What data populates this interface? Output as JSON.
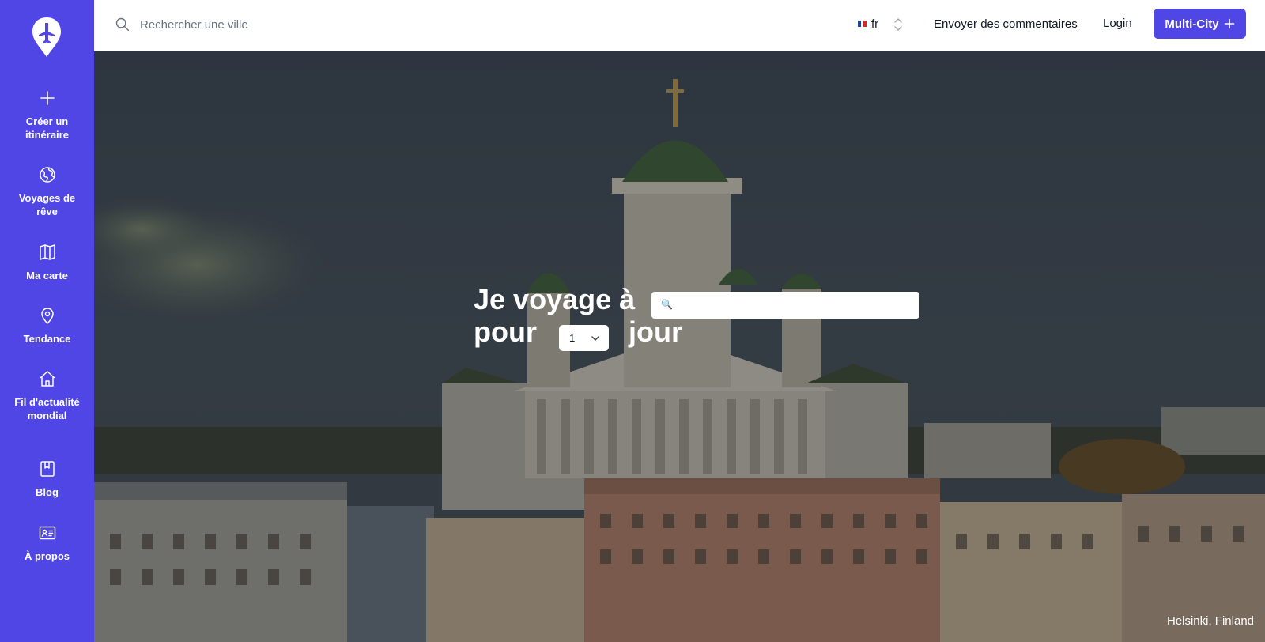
{
  "sidebar": {
    "logo_icon": "plane-pin-icon",
    "items": [
      {
        "label": "Créer un itinéraire",
        "icon": "plus-icon"
      },
      {
        "label": "Voyages de rêve",
        "icon": "globe-icon"
      },
      {
        "label": "Ma carte",
        "icon": "map-icon"
      },
      {
        "label": "Tendance",
        "icon": "map-pin-icon"
      },
      {
        "label": "Fil d'actualité mondial",
        "icon": "home-icon"
      },
      {
        "label": "Blog",
        "icon": "book-icon"
      },
      {
        "label": "À propos",
        "icon": "id-card-icon"
      }
    ]
  },
  "topbar": {
    "search_placeholder": "Rechercher une ville",
    "language": {
      "code": "fr",
      "flag": "france-flag-icon"
    },
    "feedback_label": "Envoyer des commentaires",
    "login_label": "Login",
    "multicity_label": "Multi-City",
    "multicity_icon": "plus-icon"
  },
  "hero": {
    "line1": "Je voyage à",
    "line2_prefix": "pour",
    "days_value": "1",
    "line2_suffix": "jour",
    "destination_placeholder": "",
    "search_glyph": "🔍",
    "caption": "Helsinki, Finland"
  },
  "colors": {
    "brand": "#4f46e5",
    "topbar_bg": "#ffffff",
    "text_dark": "#111827",
    "placeholder": "#6b7280"
  }
}
